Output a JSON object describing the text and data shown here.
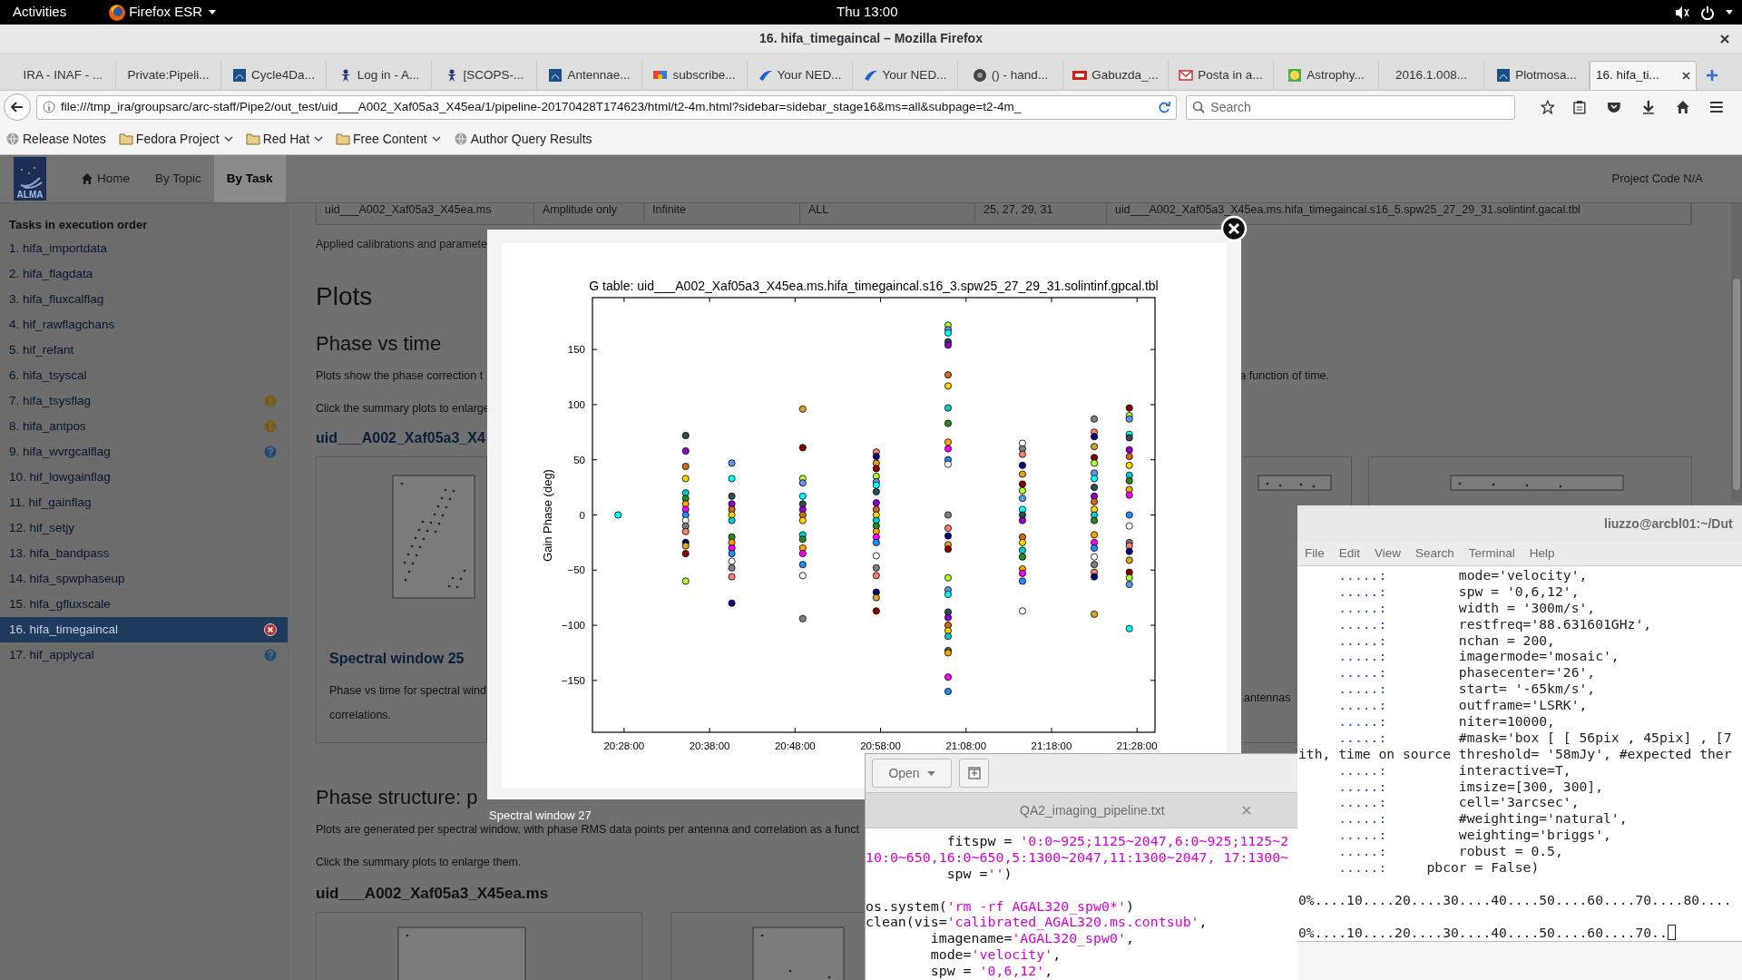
{
  "topbar": {
    "activities": "Activities",
    "app": "Firefox ESR",
    "clock": "Thu 13:00"
  },
  "browser": {
    "title": "16. hifa_timegaincal – Mozilla Firefox",
    "tabs": [
      {
        "label": "IRA - INAF - ...",
        "kind": "plain",
        "selected": false
      },
      {
        "label": "Private:Pipeli...",
        "kind": "plain",
        "selected": false
      },
      {
        "label": "Cycle4Da...",
        "kind": "square",
        "selected": false
      },
      {
        "label": "Log in - A...",
        "kind": "figure",
        "selected": false
      },
      {
        "label": "[SCOPS-...",
        "kind": "figure",
        "selected": false
      },
      {
        "label": "Antennae...",
        "kind": "square",
        "selected": false
      },
      {
        "label": "subscribe...",
        "kind": "colorful",
        "selected": false
      },
      {
        "label": "Your NED...",
        "kind": "swoosh",
        "selected": false
      },
      {
        "label": "Your NED...",
        "kind": "swoosh",
        "selected": false
      },
      {
        "label": "() - hand...",
        "kind": "circle",
        "selected": false
      },
      {
        "label": "Gabuzda_...",
        "kind": "badge",
        "selected": false
      },
      {
        "label": "Posta in a...",
        "kind": "mail",
        "selected": false
      },
      {
        "label": "Astrophy...",
        "kind": "smiley",
        "selected": false
      },
      {
        "label": "2016.1.008...",
        "kind": "plain",
        "selected": false
      },
      {
        "label": "Plotmosa...",
        "kind": "square",
        "selected": false
      },
      {
        "label": "16. hifa_ti...",
        "kind": "plain",
        "selected": true
      }
    ],
    "url": "file:///tmp_ira/groupsarc/arc-staff/Pipe2/out_test/uid___A002_Xaf05a3_X45ea/1/pipeline-20170428T174623/html/t2-4m.html?sidebar=sidebar_stage16&ms=all&subpage=t2-4m_",
    "search": {
      "placeholder": "Search"
    },
    "bookmarks": [
      {
        "label": "Release Notes",
        "kind": "link"
      },
      {
        "label": "Fedora Project",
        "kind": "folder"
      },
      {
        "label": "Red Hat",
        "kind": "folder"
      },
      {
        "label": "Free Content",
        "kind": "folder"
      },
      {
        "label": "Author Query Results",
        "kind": "link"
      }
    ]
  },
  "page": {
    "logo": "ALMA",
    "nav": [
      {
        "label": "Home",
        "selected": false
      },
      {
        "label": "By Topic",
        "selected": false
      },
      {
        "label": "By Task",
        "selected": true
      }
    ],
    "project_code": "Project Code N/A",
    "sidebar": {
      "heading": "Tasks in execution order",
      "items": [
        {
          "label": "1. hifa_importdata",
          "selected": false,
          "kind": "plain"
        },
        {
          "label": "2. hifa_flagdata",
          "selected": false,
          "kind": "plain"
        },
        {
          "label": "3. hifa_fluxcalflag",
          "selected": false,
          "kind": "plain"
        },
        {
          "label": "4. hif_rawflagchans",
          "selected": false,
          "kind": "plain"
        },
        {
          "label": "5. hif_refant",
          "selected": false,
          "kind": "plain"
        },
        {
          "label": "6. hifa_tsyscal",
          "selected": false,
          "kind": "plain"
        },
        {
          "label": "7. hifa_tsysflag",
          "selected": false,
          "kind": "warning"
        },
        {
          "label": "8. hifa_antpos",
          "selected": false,
          "kind": "warning"
        },
        {
          "label": "9. hifa_wvrgcalflag",
          "selected": false,
          "kind": "help"
        },
        {
          "label": "10. hif_lowgainflag",
          "selected": false,
          "kind": "plain"
        },
        {
          "label": "11. hif_gainflag",
          "selected": false,
          "kind": "plain"
        },
        {
          "label": "12. hif_setjy",
          "selected": false,
          "kind": "plain"
        },
        {
          "label": "13. hifa_bandpass",
          "selected": false,
          "kind": "plain"
        },
        {
          "label": "14. hifa_spwphaseup",
          "selected": false,
          "kind": "plain"
        },
        {
          "label": "15. hifa_gfluxscale",
          "selected": false,
          "kind": "plain"
        },
        {
          "label": "16. hifa_timegaincal",
          "selected": true,
          "kind": "error"
        },
        {
          "label": "17. hif_applycal",
          "selected": false,
          "kind": "help"
        }
      ]
    },
    "content": {
      "table_row": [
        "uid___A002_Xaf05a3_X45ea.ms",
        "Amplitude only",
        "Infinite",
        "ALL",
        "25, 27, 29, 31",
        "uid___A002_Xaf05a3_X45ea.ms.hifa_timegaincal.s16_5.spw25_27_29_31.solintinf.gacal.tbl"
      ],
      "applied_note": "Applied calibrations and paramete",
      "plots_heading": "Plots",
      "phase_heading": "Phase vs time",
      "phase_text": "Plots show the phase correction t",
      "phase_text_end": "a function of time.",
      "click_text": "Click the summary plots to enlarge",
      "ms_link": "uid___A002_Xaf05a3_X4",
      "card_title": "Spectral window 25",
      "card_text": "Phase vs time for spectral wind",
      "card_text_2": "correlations.",
      "card_text_end": "antennas",
      "structure_heading": "Phase structure: p",
      "structure_text": "Plots are generated per spectral window, with phase RMS data points per antenna and correlation as a funct",
      "structure_click": "Click the summary plots to enlarge them.",
      "structure_ms": "uid___A002_Xaf05a3_X45ea.ms"
    }
  },
  "lightbox": {
    "caption": "Spectral window 27",
    "chart_data": {
      "type": "scatter",
      "title": "G table: uid___A002_Xaf05a3_X45ea.ms.hifa_timegaincal.s16_3.spw25_27_29_31.solintinf.gpcal.tbl",
      "ylabel": "Gain Phase (deg)",
      "xlim": [
        73458,
        77406
      ],
      "ylim": [
        -197,
        197
      ],
      "xticks": [
        {
          "value": 73680,
          "label": "20:28:00"
        },
        {
          "value": 74280,
          "label": "20:38:00"
        },
        {
          "value": 74880,
          "label": "20:48:00"
        },
        {
          "value": 75480,
          "label": "20:58:00"
        },
        {
          "value": 76080,
          "label": "21:08:00"
        },
        {
          "value": 76680,
          "label": "21:18:00"
        },
        {
          "value": 77280,
          "label": "21:28:00"
        }
      ],
      "yticks": [
        {
          "value": -150,
          "label": "−150"
        },
        {
          "value": -100,
          "label": "−100"
        },
        {
          "value": -50,
          "label": "−50"
        },
        {
          "value": 0,
          "label": "0"
        },
        {
          "value": 50,
          "label": "50"
        },
        {
          "value": 100,
          "label": "100"
        },
        {
          "value": 150,
          "label": "150"
        }
      ],
      "x": [
        73638,
        74112,
        74112,
        74112,
        74112,
        74112,
        74112,
        74112,
        74112,
        74112,
        74112,
        74112,
        74112,
        74112,
        74112,
        74112,
        74112,
        74436,
        74436,
        74436,
        74436,
        74436,
        74436,
        74436,
        74436,
        74436,
        74436,
        74436,
        74436,
        74436,
        74436,
        74436,
        74934,
        74934,
        74934,
        74934,
        74934,
        74934,
        74934,
        74934,
        74934,
        74934,
        74934,
        74934,
        74934,
        74934,
        74934,
        74934,
        75450,
        75450,
        75450,
        75450,
        75450,
        75450,
        75450,
        75450,
        75450,
        75450,
        75450,
        75450,
        75450,
        75450,
        75450,
        75450,
        75450,
        75450,
        75450,
        75450,
        75450,
        75450,
        75954,
        75954,
        75954,
        75954,
        75954,
        75954,
        75954,
        75954,
        75954,
        75954,
        75954,
        75954,
        75954,
        75954,
        75954,
        75954,
        75954,
        75954,
        75954,
        75954,
        75954,
        75954,
        75954,
        75954,
        75954,
        75954,
        75954,
        75954,
        75954,
        75954,
        76476,
        76476,
        76476,
        76476,
        76476,
        76476,
        76476,
        76476,
        76476,
        76476,
        76476,
        76476,
        76476,
        76476,
        76476,
        76476,
        76476,
        76476,
        76476,
        76980,
        76980,
        76980,
        76980,
        76980,
        76980,
        76980,
        76980,
        76980,
        76980,
        76980,
        76980,
        76980,
        76980,
        76980,
        76980,
        76980,
        76980,
        76980,
        76980,
        76980,
        76980,
        77226,
        77226,
        77226,
        77226,
        77226,
        77226,
        77226,
        77226,
        77226,
        77226,
        77226,
        77226,
        77226,
        77226,
        77226,
        77226,
        77226,
        77226,
        77226,
        77226,
        77226,
        77226
      ],
      "values": [
        0,
        72,
        58,
        44,
        33,
        20,
        15,
        10,
        5,
        0,
        -5,
        -10,
        -15,
        -25,
        -28,
        -35,
        -60,
        47,
        33,
        17,
        10,
        5,
        0,
        -5,
        -20,
        -25,
        -30,
        -35,
        -42,
        -48,
        -56,
        -80,
        96,
        61,
        33,
        29,
        17,
        10,
        5,
        0,
        -5,
        -18,
        -22,
        -30,
        -35,
        -45,
        -55,
        -94,
        57,
        53,
        47,
        42,
        35,
        30,
        27,
        21,
        11,
        5,
        0,
        -5,
        -10,
        -15,
        -20,
        -25,
        -37,
        -48,
        -55,
        -70,
        -75,
        -87,
        172,
        168,
        165,
        157,
        154,
        127,
        117,
        97,
        83,
        66,
        60,
        50,
        46,
        0,
        -12,
        -19,
        -27,
        -31,
        -57,
        -68,
        -72,
        -88,
        -93,
        -100,
        -105,
        -110,
        -123,
        -125,
        -147,
        -160,
        65,
        60,
        55,
        45,
        37,
        28,
        22,
        15,
        5,
        0,
        -5,
        -20,
        -25,
        -32,
        -38,
        -49,
        -53,
        -60,
        -87,
        87,
        75,
        71,
        62,
        52,
        47,
        38,
        33,
        25,
        17,
        12,
        5,
        0,
        -5,
        -18,
        -25,
        -30,
        -38,
        -45,
        -52,
        -56,
        -90,
        97,
        90,
        87,
        73,
        70,
        59,
        53,
        45,
        36,
        31,
        23,
        18,
        0,
        -10,
        -25,
        -28,
        -33,
        -41,
        -52,
        -57,
        -63,
        -103
      ]
    }
  },
  "editor": {
    "open_button": "Open",
    "tab": "QA2_imaging_pipeline.txt",
    "blocks": [
      {
        "lines": [
          [
            {
              "kind": "code",
              "text": "          fitspw = "
            },
            {
              "kind": "string",
              "text": "'0:0~925;1125~2047,6:0~925;1125~2"
            }
          ],
          [
            {
              "kind": "string",
              "text": "10:0~650,16:0~650,5:1300~2047,11:1300~2047, 17:1300~"
            }
          ],
          [
            {
              "kind": "code",
              "text": "          spw ="
            },
            {
              "kind": "string",
              "text": "''"
            },
            {
              "kind": "code",
              "text": ")"
            }
          ]
        ]
      },
      {
        "lines": [
          [
            {
              "kind": "code",
              "text": "os.system("
            },
            {
              "kind": "string",
              "text": "'rm -rf AGAL320_spw0*'"
            },
            {
              "kind": "code",
              "text": ")"
            }
          ],
          [
            {
              "kind": "code",
              "text": "clean(vis="
            },
            {
              "kind": "string",
              "text": "'calibrated_AGAL320.ms.contsub'"
            },
            {
              "kind": "code",
              "text": ","
            }
          ],
          [
            {
              "kind": "code",
              "text": "        imagename="
            },
            {
              "kind": "string",
              "text": "'AGAL320_spw0'"
            },
            {
              "kind": "code",
              "text": ","
            }
          ],
          [
            {
              "kind": "code",
              "text": "        mode="
            },
            {
              "kind": "string",
              "text": "'velocity'"
            },
            {
              "kind": "code",
              "text": ","
            }
          ],
          [
            {
              "kind": "code",
              "text": "        spw = "
            },
            {
              "kind": "string",
              "text": "'0,6,12'"
            },
            {
              "kind": "code",
              "text": ","
            }
          ]
        ]
      }
    ]
  },
  "terminal": {
    "title": "liuzzo@arcbl01:~/Dut",
    "menu": [
      "File",
      "Edit",
      "View",
      "Search",
      "Terminal",
      "Help"
    ],
    "blocks": [
      {
        "lines": [
          {
            "prompt": ".....:",
            "code": "         mode='velocity',",
            "cursor": false
          },
          {
            "prompt": ".....:",
            "code": "         spw = '0,6,12',",
            "cursor": false
          },
          {
            "prompt": ".....:",
            "code": "         width = '300m/s',",
            "cursor": false
          },
          {
            "prompt": ".....:",
            "code": "         restfreq='88.631601GHz',",
            "cursor": false
          },
          {
            "prompt": ".....:",
            "code": "         nchan = 200,",
            "cursor": false
          },
          {
            "prompt": ".....:",
            "code": "         imagermode='mosaic',",
            "cursor": false
          },
          {
            "prompt": ".....:",
            "code": "         phasecenter='26',",
            "cursor": false
          },
          {
            "prompt": ".....:",
            "code": "         start= '-65km/s',",
            "cursor": false
          },
          {
            "prompt": ".....:",
            "code": "         outframe='LSRK',",
            "cursor": false
          },
          {
            "prompt": ".....:",
            "code": "         niter=10000,",
            "cursor": false
          },
          {
            "prompt": ".....:",
            "code": "         #mask='box [ [ 56pix , 45pix] , [7",
            "cursor": false
          },
          {
            "code": "ith, time on source threshold= '58mJy', #expected ther",
            "cursor": false
          },
          {
            "prompt": ".....:",
            "code": "         interactive=T,",
            "cursor": false
          },
          {
            "prompt": ".....:",
            "code": "         imsize=[300, 300],",
            "cursor": false
          },
          {
            "prompt": ".....:",
            "code": "         cell='3arcsec',",
            "cursor": false
          },
          {
            "prompt": ".....:",
            "code": "         #weighting='natural',",
            "cursor": false
          },
          {
            "prompt": ".....:",
            "code": "         weighting='briggs',",
            "cursor": false
          },
          {
            "prompt": ".....:",
            "code": "         robust = 0.5,",
            "cursor": false
          },
          {
            "prompt": ".....:",
            "code": "     pbcor = False)",
            "cursor": false
          }
        ]
      },
      {
        "lines": [
          {
            "code": "0%....10....20....30....40....50....60....70....80....",
            "cursor": false
          }
        ]
      },
      {
        "lines": [
          {
            "code": "0%....10....20....30....40....50....60....70..",
            "cursor": true
          }
        ]
      }
    ]
  }
}
